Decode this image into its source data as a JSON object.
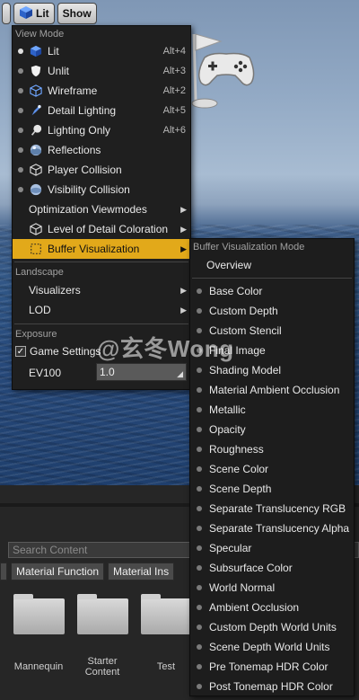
{
  "toolbar": {
    "lit_label": "Lit",
    "show_label": "Show"
  },
  "browser": {
    "search_placeholder": "Search Content",
    "filters": [
      "Material Function",
      "Material Ins"
    ],
    "assets": [
      {
        "name": "Mannequin"
      },
      {
        "name": "Starter Content"
      },
      {
        "name": "Test"
      }
    ]
  },
  "view_menu": {
    "header": "View Mode",
    "items": [
      {
        "label": "Lit",
        "shortcut": "Alt+4",
        "icon": "lit-sphere-icon",
        "selected": true
      },
      {
        "label": "Unlit",
        "shortcut": "Alt+3",
        "icon": "unlit-shield-icon"
      },
      {
        "label": "Wireframe",
        "shortcut": "Alt+2",
        "icon": "wireframe-cube-icon"
      },
      {
        "label": "Detail Lighting",
        "shortcut": "Alt+5",
        "icon": "detail-lighting-icon"
      },
      {
        "label": "Lighting Only",
        "shortcut": "Alt+6",
        "icon": "lighting-only-icon"
      },
      {
        "label": "Reflections",
        "shortcut": "",
        "icon": "reflections-sphere-icon"
      },
      {
        "label": "Player Collision",
        "shortcut": "",
        "icon": "player-collision-icon"
      },
      {
        "label": "Visibility Collision",
        "shortcut": "",
        "icon": "visibility-collision-icon"
      }
    ],
    "optimization": "Optimization Viewmodes",
    "lod_coloration": "Level of Detail Coloration",
    "buffer_visualization": "Buffer Visualization",
    "landscape_header": "Landscape",
    "visualizers": "Visualizers",
    "lod": "LOD",
    "exposure_header": "Exposure",
    "game_settings": "Game Settings",
    "ev100_label": "EV100",
    "ev100_value": "1.0"
  },
  "buffer_menu": {
    "header": "Buffer Visualization Mode",
    "overview": "Overview",
    "items": [
      "Base Color",
      "Custom Depth",
      "Custom Stencil",
      "Final Image",
      "Shading Model",
      "Material Ambient Occlusion",
      "Metallic",
      "Opacity",
      "Roughness",
      "Scene Color",
      "Scene Depth",
      "Separate Translucency RGB",
      "Separate Translucency Alpha",
      "Specular",
      "Subsurface Color",
      "World Normal",
      "Ambient Occlusion",
      "Custom Depth World Units",
      "Scene Depth World Units",
      "Pre Tonemap HDR Color",
      "Post Tonemap HDR Color"
    ]
  },
  "watermark": "@玄冬Wong",
  "colors": {
    "highlight": "#e2a91a",
    "menu_bg": "#1f1f1f"
  }
}
